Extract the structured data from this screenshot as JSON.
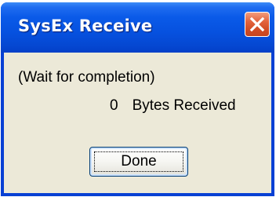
{
  "window": {
    "title": "SysEx Receive"
  },
  "dialog": {
    "status_message": "(Wait for completion)",
    "byte_count": "0",
    "bytes_label": "Bytes Received",
    "done_label": "Done"
  },
  "icons": {
    "close": "close-icon"
  },
  "colors": {
    "title_bar": "#0651df",
    "close_button": "#e2613b",
    "client_background": "#ece9d8",
    "button_border": "#003c74"
  }
}
